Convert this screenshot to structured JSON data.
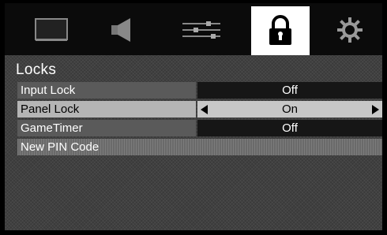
{
  "tabs": [
    {
      "icon": "picture-icon"
    },
    {
      "icon": "speaker-icon"
    },
    {
      "icon": "settings-sliders-icon"
    },
    {
      "icon": "lock-icon",
      "active": true
    },
    {
      "icon": "gear-icon"
    }
  ],
  "panel": {
    "title": "Locks",
    "rows": [
      {
        "label": "Input Lock",
        "value": "Off"
      },
      {
        "label": "Panel Lock",
        "value": "On",
        "selected": true
      },
      {
        "label": "GameTimer",
        "value": "Off"
      },
      {
        "label": "New PIN Code",
        "value": ""
      }
    ]
  },
  "colors": {
    "background": "#000000",
    "panel": "#3a3a3a",
    "label_bg": "#5a5a5a",
    "value_bg": "#161616",
    "selected_bg": "#c7c7c7"
  }
}
